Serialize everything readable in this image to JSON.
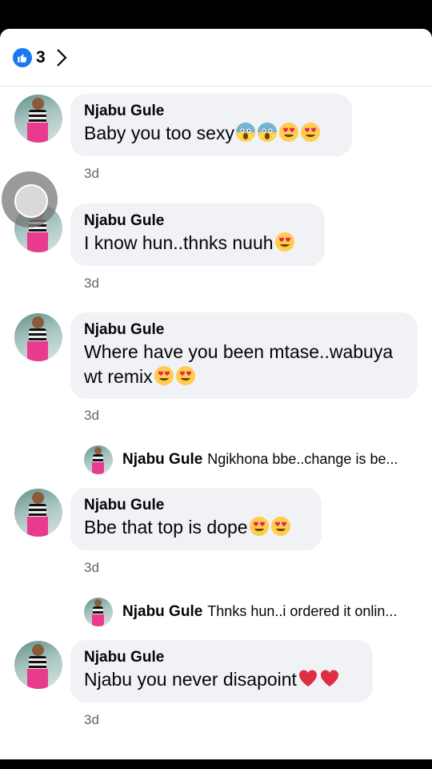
{
  "header": {
    "like_count": "3"
  },
  "comments": [
    {
      "author": "Njabu Gule",
      "text": "Baby you too sexy",
      "emoji": [
        "scream",
        "scream",
        "heart-eyes",
        "heart-eyes"
      ],
      "time": "3d"
    },
    {
      "author": "Njabu Gule",
      "text": "I know hun..thnks nuuh",
      "emoji": [
        "heart-eyes"
      ],
      "time": "3d"
    },
    {
      "author": "Njabu Gule",
      "text": "Where have you been mtase..wabuya\nwt remix",
      "emoji": [
        "heart-eyes",
        "heart-eyes"
      ],
      "time": "3d",
      "reply": {
        "author": "Njabu Gule",
        "text": "Ngikhona bbe..change is be..."
      }
    },
    {
      "author": "Njabu Gule",
      "text": "Bbe that top is dope",
      "emoji": [
        "heart-eyes",
        "heart-eyes"
      ],
      "time": "3d",
      "reply": {
        "author": "Njabu Gule",
        "text": "Thnks hun..i ordered it onlin..."
      }
    },
    {
      "author": "Njabu Gule",
      "text": "Njabu you never disapoint",
      "emoji": [
        "red-heart",
        "red-heart"
      ],
      "time": "3d"
    }
  ],
  "colors": {
    "like_blue": "#1877f2",
    "bubble": "#f0f2f5",
    "meta_gray": "#65676b"
  }
}
